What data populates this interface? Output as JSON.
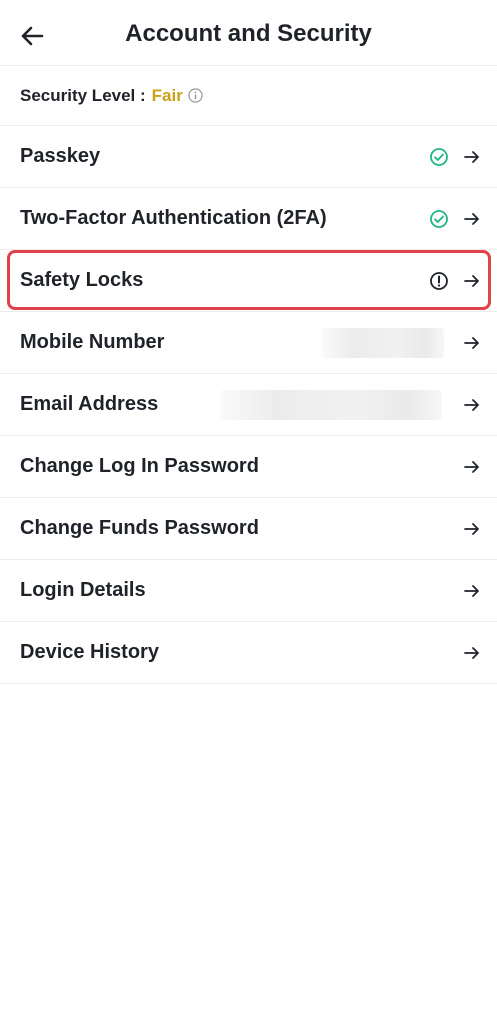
{
  "header": {
    "title": "Account and Security"
  },
  "security": {
    "label": "Security Level :",
    "value": "Fair"
  },
  "rows": [
    {
      "label": "Passkey",
      "status": "check"
    },
    {
      "label": "Two-Factor Authentication (2FA)",
      "status": "check"
    },
    {
      "label": "Safety Locks",
      "status": "warning"
    },
    {
      "label": "Mobile Number"
    },
    {
      "label": "Email Address"
    },
    {
      "label": "Change Log In Password"
    },
    {
      "label": "Change Funds Password"
    },
    {
      "label": "Login Details"
    },
    {
      "label": "Device History"
    }
  ],
  "colors": {
    "accent_fair": "#c9a21a",
    "check_green": "#1fb77e",
    "highlight_red": "#e0424a"
  }
}
